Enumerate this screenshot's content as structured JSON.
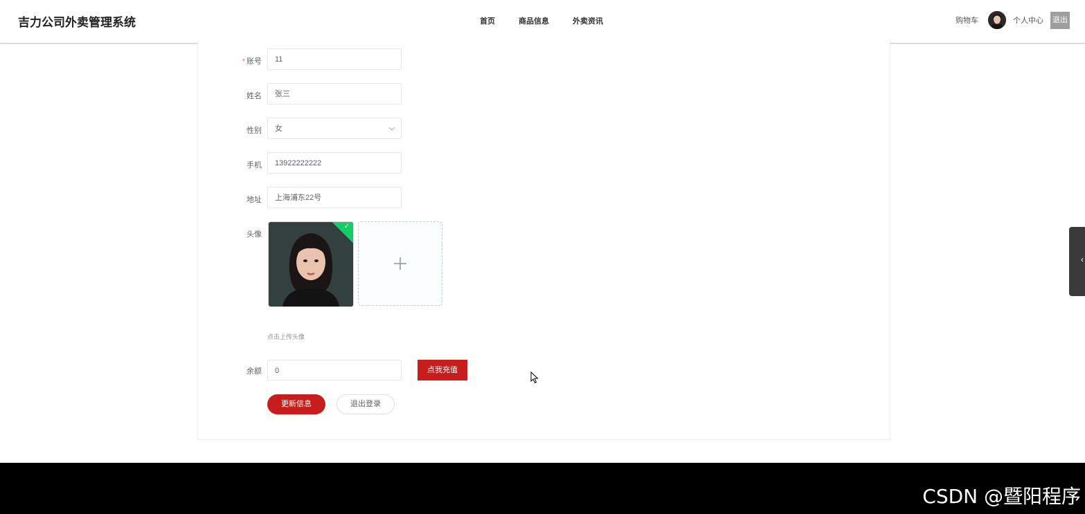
{
  "header": {
    "title": "吉力公司外卖管理系统",
    "nav": [
      "首页",
      "商品信息",
      "外卖资讯"
    ],
    "cart_label": "购物车",
    "user_center_label": "个人中心",
    "logout_label": "退出"
  },
  "form": {
    "account": {
      "label": "账号",
      "required_mark": "*",
      "value": "11"
    },
    "name": {
      "label": "姓名",
      "value": "张三"
    },
    "gender": {
      "label": "性别",
      "value": "女"
    },
    "phone": {
      "label": "手机",
      "value": "13922222222"
    },
    "address": {
      "label": "地址",
      "value": "上海浦东22号"
    },
    "avatar": {
      "label": "头像",
      "tip": "点击上传头像"
    },
    "balance": {
      "label": "余额",
      "value": "0",
      "recharge_label": "点我充值"
    },
    "update_label": "更新信息",
    "logout_login_label": "退出登录"
  },
  "footer": {
    "watermark": "CSDN @暨阳程序"
  },
  "colors": {
    "primary": "#c81d1d",
    "success": "#13ce66"
  }
}
